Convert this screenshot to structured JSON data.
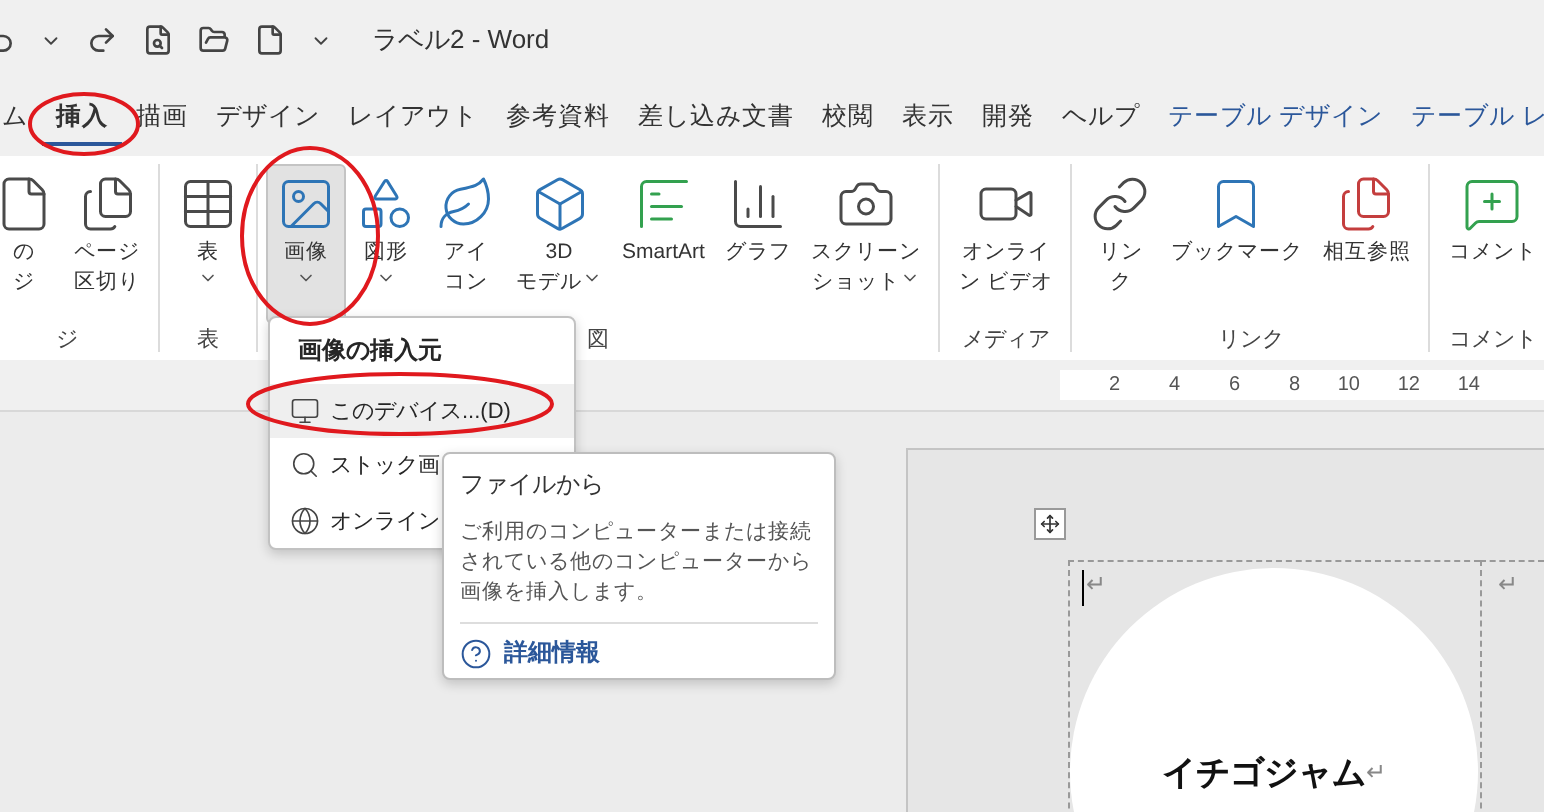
{
  "title_bar": {
    "title": "ラベル2 - Word"
  },
  "tabs": [
    {
      "label": "ム",
      "selected": false,
      "contextual": false
    },
    {
      "label": "挿入",
      "selected": true,
      "contextual": false
    },
    {
      "label": "描画",
      "selected": false,
      "contextual": false
    },
    {
      "label": "デザイン",
      "selected": false,
      "contextual": false
    },
    {
      "label": "レイアウト",
      "selected": false,
      "contextual": false
    },
    {
      "label": "参考資料",
      "selected": false,
      "contextual": false
    },
    {
      "label": "差し込み文書",
      "selected": false,
      "contextual": false
    },
    {
      "label": "校閲",
      "selected": false,
      "contextual": false
    },
    {
      "label": "表示",
      "selected": false,
      "contextual": false
    },
    {
      "label": "開発",
      "selected": false,
      "contextual": false
    },
    {
      "label": "ヘルプ",
      "selected": false,
      "contextual": false
    },
    {
      "label": "テーブル デザイン",
      "selected": false,
      "contextual": true
    },
    {
      "label": "テーブル レ",
      "selected": false,
      "contextual": true
    }
  ],
  "ribbon": [
    {
      "label": "ジ",
      "buttons": [
        {
          "kind": "page",
          "lines": [
            "の",
            "ジ"
          ],
          "dropdown": false,
          "selected": false
        },
        {
          "kind": "pagebreak",
          "lines": [
            "ページ",
            "区切り"
          ],
          "dropdown": false,
          "selected": false
        }
      ]
    },
    {
      "label": "表",
      "buttons": [
        {
          "kind": "table",
          "lines": [
            "表"
          ],
          "dropdown": true,
          "selected": false
        }
      ]
    },
    {
      "label": "図",
      "buttons": [
        {
          "kind": "picture",
          "lines": [
            "画像"
          ],
          "dropdown": true,
          "selected": true
        },
        {
          "kind": "shapes",
          "lines": [
            "図形"
          ],
          "dropdown": true,
          "selected": false
        },
        {
          "kind": "icons",
          "lines": [
            "アイ",
            "コン"
          ],
          "dropdown": false,
          "selected": false
        },
        {
          "kind": "model3d",
          "lines": [
            "3D",
            "モデル"
          ],
          "dropdown": true,
          "selected": false
        },
        {
          "kind": "smartart",
          "lines": [
            "SmartArt"
          ],
          "dropdown": false,
          "selected": false
        },
        {
          "kind": "chart",
          "lines": [
            "グラフ"
          ],
          "dropdown": false,
          "selected": false
        },
        {
          "kind": "screenshot",
          "lines": [
            "スクリーン",
            "ショット"
          ],
          "dropdown": true,
          "selected": false
        }
      ]
    },
    {
      "label": "メディア",
      "buttons": [
        {
          "kind": "video",
          "lines": [
            "オンライ",
            "ン ビデオ"
          ],
          "dropdown": false,
          "selected": false
        }
      ]
    },
    {
      "label": "リンク",
      "buttons": [
        {
          "kind": "link",
          "lines": [
            "リン",
            "ク"
          ],
          "dropdown": false,
          "selected": false
        },
        {
          "kind": "bookmark",
          "lines": [
            "ブックマーク"
          ],
          "dropdown": false,
          "selected": false
        },
        {
          "kind": "crossref",
          "lines": [
            "相互参照"
          ],
          "dropdown": false,
          "selected": false
        }
      ]
    },
    {
      "label": "コメント",
      "buttons": [
        {
          "kind": "comment",
          "lines": [
            "コメント"
          ],
          "dropdown": false,
          "selected": false
        }
      ]
    }
  ],
  "ruler": {
    "numbers": [
      "2",
      "4",
      "6",
      "8",
      "10",
      "12",
      "14"
    ]
  },
  "document": {
    "cell_marks": [
      "↵",
      "↵"
    ],
    "label_text": "イチゴジャム",
    "label_mark": "↵"
  },
  "picture_menu": {
    "header": "画像の挿入元",
    "items": [
      {
        "kind": "device",
        "label": "このデバイス...(D)",
        "selected": true
      },
      {
        "kind": "stock",
        "label": "ストック画",
        "selected": false
      },
      {
        "kind": "online",
        "label": "オンライン",
        "selected": false
      }
    ]
  },
  "tooltip": {
    "title": "ファイルから",
    "description": "ご利用のコンピューターまたは接続されている他のコンピューターから画像を挿入します。",
    "link": "詳細情報"
  }
}
